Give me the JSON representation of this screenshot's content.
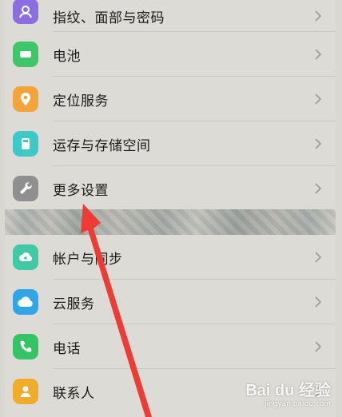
{
  "settings": {
    "group_a": [
      {
        "label": "指纹、面部与密码",
        "icon": "fingerprint-face-icon",
        "color": "#8b6fe0"
      },
      {
        "label": "电池",
        "icon": "battery-icon",
        "color": "#3ec76a"
      },
      {
        "label": "定位服务",
        "icon": "location-pin-icon",
        "color": "#f3a43a"
      },
      {
        "label": "运存与存储空间",
        "icon": "storage-icon",
        "color": "#3fc8c8"
      },
      {
        "label": "更多设置",
        "icon": "wrench-icon",
        "color": "#8f8f8f"
      }
    ],
    "group_b": [
      {
        "label": "帐户与同步",
        "icon": "account-sync-icon",
        "color": "#3fcaa5"
      },
      {
        "label": "云服务",
        "icon": "cloud-icon",
        "color": "#2fa6e8"
      },
      {
        "label": "电话",
        "icon": "phone-icon",
        "color": "#35c465"
      },
      {
        "label": "联系人",
        "icon": "contact-icon",
        "color": "#f2ac2c"
      }
    ]
  },
  "annotation": {
    "arrow_color": "#ee3b35"
  },
  "watermark": {
    "logo": "Bai du 经验",
    "site": "jingyan.baidu.com"
  }
}
